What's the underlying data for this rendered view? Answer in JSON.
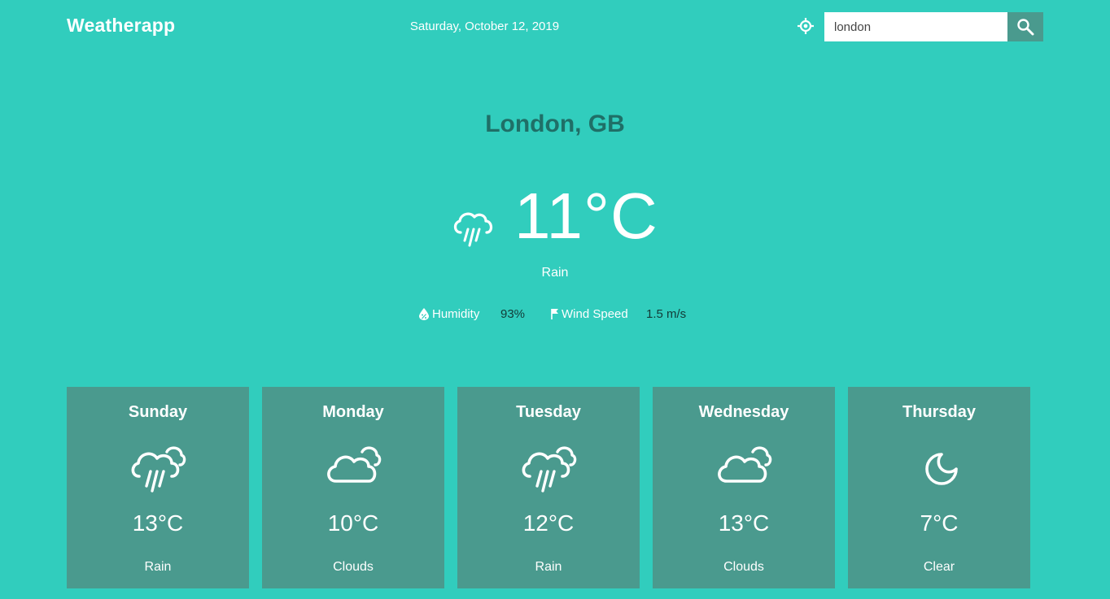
{
  "header": {
    "brand": "Weatherapp",
    "date": "Saturday, October 12, 2019",
    "search": {
      "value": "london",
      "placeholder": ""
    },
    "locate_icon": "crosshair-icon",
    "search_icon": "search-icon"
  },
  "current": {
    "city": "London, GB",
    "temperature": "11°C",
    "description": "Rain",
    "icon": "rain-cloud-icon",
    "humidity_label": "Humidity",
    "humidity_value": "93%",
    "wind_label": "Wind Speed",
    "wind_value": "1.5 m/s"
  },
  "forecast": [
    {
      "day": "Sunday",
      "temp": "13°C",
      "desc": "Rain",
      "icon": "rain-cloud-icon"
    },
    {
      "day": "Monday",
      "temp": "10°C",
      "desc": "Clouds",
      "icon": "clouds-icon"
    },
    {
      "day": "Tuesday",
      "temp": "12°C",
      "desc": "Rain",
      "icon": "rain-cloud-icon"
    },
    {
      "day": "Wednesday",
      "temp": "13°C",
      "desc": "Clouds",
      "icon": "clouds-icon"
    },
    {
      "day": "Thursday",
      "temp": "7°C",
      "desc": "Clear",
      "icon": "moon-icon"
    }
  ],
  "colors": {
    "background": "#31cdbd",
    "card": "#4a9a8e",
    "city_text": "#1f6f67",
    "value_text": "#123b37"
  }
}
